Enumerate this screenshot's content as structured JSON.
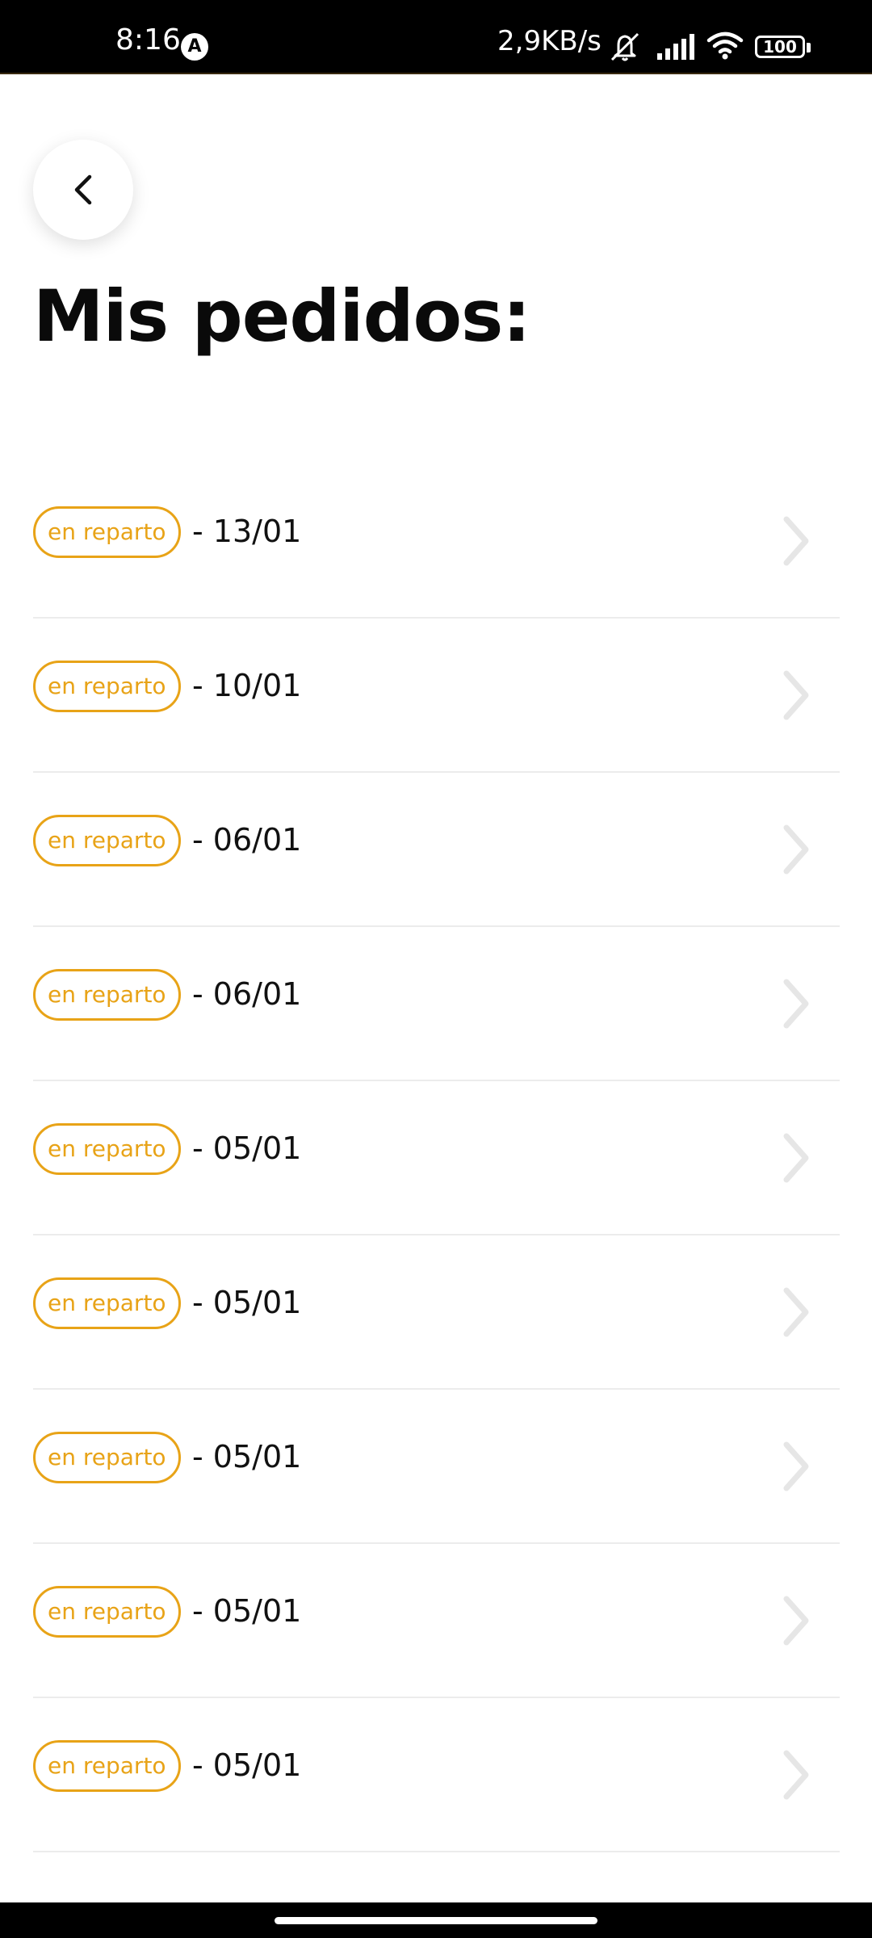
{
  "status_bar": {
    "time": "8:16",
    "notification_glyph": "A",
    "network_speed": "2,9KB/s",
    "battery_level": "100",
    "icons": [
      "mute-icon",
      "signal-icon",
      "wifi-icon",
      "battery-icon"
    ]
  },
  "header": {
    "back_icon": "chevron-left-icon",
    "title": "Mis pedidos:"
  },
  "orders": [
    {
      "status": "en reparto",
      "date": "- 13/01"
    },
    {
      "status": "en reparto",
      "date": "- 10/01"
    },
    {
      "status": "en reparto",
      "date": "- 06/01"
    },
    {
      "status": "en reparto",
      "date": "- 06/01"
    },
    {
      "status": "en reparto",
      "date": "- 05/01"
    },
    {
      "status": "en reparto",
      "date": "- 05/01"
    },
    {
      "status": "en reparto",
      "date": "- 05/01"
    },
    {
      "status": "en reparto",
      "date": "- 05/01"
    },
    {
      "status": "en reparto",
      "date": "- 05/01"
    }
  ],
  "colors": {
    "accent": "#e8a317",
    "divider": "#ececec",
    "chevron": "#e6e6e6",
    "title": "#0a0a0a"
  }
}
